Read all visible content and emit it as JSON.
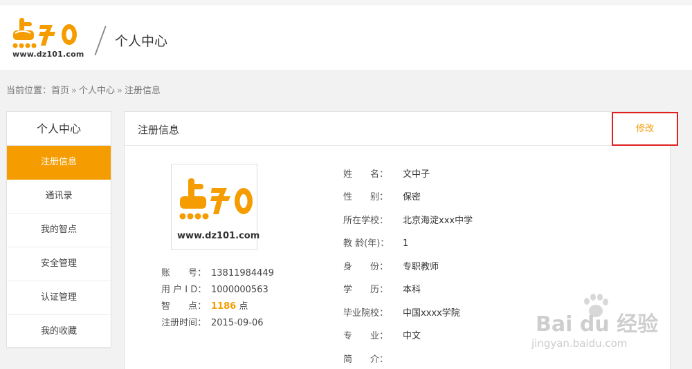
{
  "logo": {
    "url_text": "www.dz101.com"
  },
  "header": {
    "title": "个人中心"
  },
  "breadcrumb": {
    "prefix": "当前位置：",
    "home": "首页",
    "sep": "»",
    "center": "个人中心",
    "current": "注册信息"
  },
  "sidebar": {
    "title": "个人中心",
    "items": [
      {
        "label": "注册信息",
        "active": true
      },
      {
        "label": "通讯录"
      },
      {
        "label": "我的智点"
      },
      {
        "label": "安全管理"
      },
      {
        "label": "认证管理"
      },
      {
        "label": "我的收藏"
      }
    ]
  },
  "panel": {
    "title": "注册信息",
    "edit_label": "修改"
  },
  "account": {
    "account_label": "账　　号：",
    "account_value": "13811984449",
    "userid_label": "用 户 I D：",
    "userid_value": "1000000563",
    "points_label": "智　　点：",
    "points_value": "1186",
    "points_unit": " 点",
    "regtime_label": "注册时间：",
    "regtime_value": "2015-09-06"
  },
  "profile": [
    {
      "label": "姓　　名：",
      "value": "文中子"
    },
    {
      "label": "性　　别：",
      "value": "保密"
    },
    {
      "label": "所在学校：",
      "value": "北京海淀xxx中学"
    },
    {
      "label": "教 龄(年)：",
      "value": "1"
    },
    {
      "label": "身　　份：",
      "value": "专职教师"
    },
    {
      "label": "学　　历：",
      "value": "本科"
    },
    {
      "label": "毕业院校：",
      "value": "中国xxxx学院"
    },
    {
      "label": "专　　业：",
      "value": "中文"
    },
    {
      "label": "简　　介：",
      "value": ""
    }
  ],
  "watermark": {
    "text": "Bai du 经验",
    "sub": "jingyan.baidu.com"
  },
  "colors": {
    "accent": "#f59c00",
    "highlight_border": "#e02020"
  }
}
